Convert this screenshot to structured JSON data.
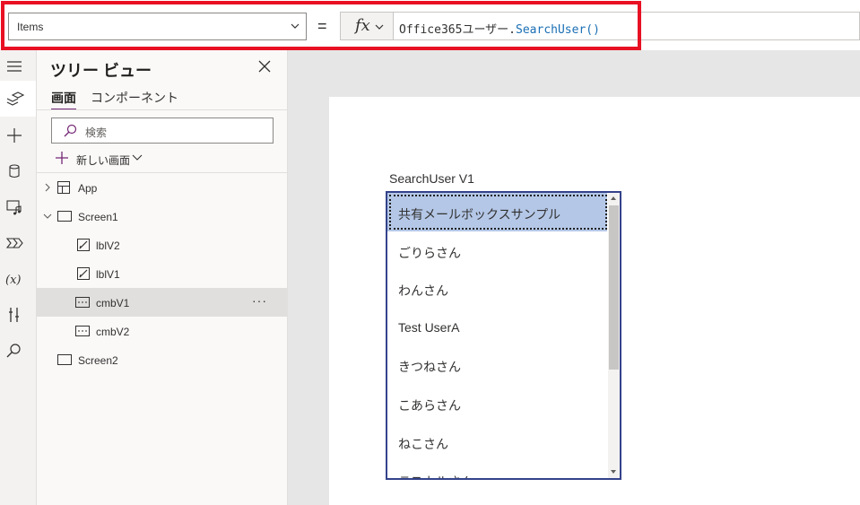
{
  "formula_bar": {
    "property": "Items",
    "equals": "=",
    "fx_label": "fx",
    "formula_object": "Office365ユーザー.",
    "formula_function": "SearchUser()"
  },
  "rail": {
    "icons": [
      "hamburger-icon",
      "layers-icon",
      "plus-icon",
      "database-icon",
      "media-icon",
      "advanced-tools-icon",
      "variables-icon",
      "tools-icon",
      "search-icon"
    ],
    "variables_label": "(x)"
  },
  "tree_panel": {
    "title": "ツリー ビュー",
    "tabs": [
      {
        "label": "画面",
        "active": true
      },
      {
        "label": "コンポーネント",
        "active": false
      }
    ],
    "search_placeholder": "検索",
    "new_screen_label": "新しい画面",
    "nodes": [
      {
        "label": "App",
        "type": "app",
        "level": 0,
        "expander": "collapsed"
      },
      {
        "label": "Screen1",
        "type": "screen",
        "level": 0,
        "expander": "expanded"
      },
      {
        "label": "lblV2",
        "type": "label",
        "level": 1
      },
      {
        "label": "lblV1",
        "type": "label",
        "level": 1
      },
      {
        "label": "cmbV1",
        "type": "combobox",
        "level": 1,
        "selected": true,
        "more": "···"
      },
      {
        "label": "cmbV2",
        "type": "combobox",
        "level": 1
      },
      {
        "label": "Screen2",
        "type": "screen",
        "level": 0
      }
    ]
  },
  "canvas": {
    "combo_label": "SearchUser V1",
    "items": [
      "共有メールボックスサンプル",
      "ごりらさん",
      "わんさん",
      "Test UserA",
      "きつねさん",
      "こあらさん",
      "ねこさん",
      "ラスカルさん"
    ],
    "highlighted_index": 0
  },
  "colors": {
    "highlight_frame": "#e81123",
    "accent": "#742774",
    "list_border": "#34428a",
    "item_highlight": "#b4c7e7",
    "function_text": "#1a6fb5"
  }
}
